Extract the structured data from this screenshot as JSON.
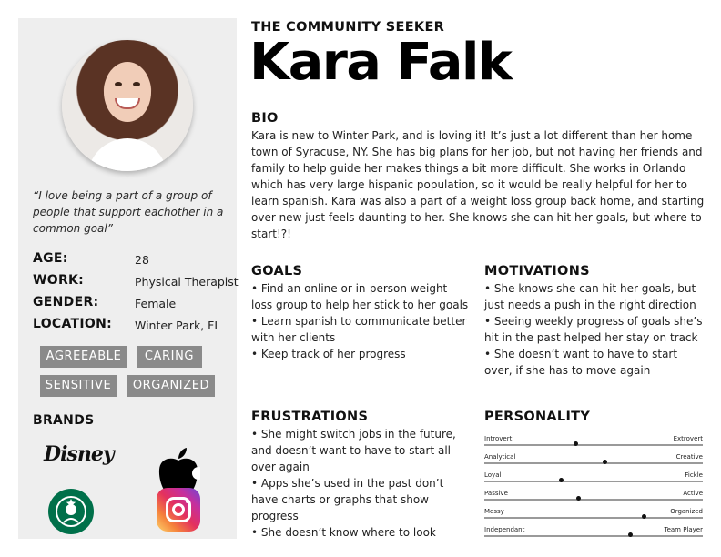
{
  "persona": {
    "kicker": "THE COMMUNITY SEEKER",
    "name": "Kara Falk",
    "quote": "“I love being a part of a group of people that support eachother in a common goal”"
  },
  "stats": [
    {
      "label": "AGE:",
      "value": "28"
    },
    {
      "label": "WORK:",
      "value": "Physical Therapist"
    },
    {
      "label": "GENDER:",
      "value": "Female"
    },
    {
      "label": "LOCATION:",
      "value": "Winter Park, FL"
    }
  ],
  "tags": [
    "AGREEABLE",
    "CARING",
    "SENSITIVE",
    "ORGANIZED"
  ],
  "brands": {
    "title": "BRANDS",
    "disney": "Disney",
    "starbucks": "STARBUCKS COFFEE",
    "icons": [
      "disney-logo",
      "apple-logo",
      "starbucks-logo",
      "instagram-logo"
    ]
  },
  "bio": {
    "title": "BIO",
    "text": "Kara is new to Winter Park, and is loving it! It’s just a lot different than her home town of Syracuse, NY. She has big plans for her job, but not having her friends and family to help guide her makes things a bit more difficult. She works in Orlando which has very large hispanic population, so it would be really helpful for her to learn spanish. Kara was also a part of a weight loss group back home, and starting over new just feels daunting to her. She knows she can hit her goals, but where to start!?!"
  },
  "goals": {
    "title": "GOALS",
    "items": [
      "• Find an online or in-person weight loss group to help her stick to her goals",
      "• Learn spanish to communicate better with her clients",
      "• Keep track of her progress"
    ]
  },
  "motivations": {
    "title": "MOTIVATIONS",
    "items": [
      "• She knows she can hit her goals, but just needs a push in the right direction",
      "• Seeing weekly progress of goals she’s hit in the past helped her stay on track",
      "• She doesn’t want to have to start over, if she has to move again"
    ]
  },
  "frustrations": {
    "title": "FRUSTRATIONS",
    "items": [
      "• She might switch jobs in the future, and doesn’t want to have to start all over again",
      "• Apps she’s used in the past don’t have charts or graphs that show progress",
      "• She doesn’t know where to look"
    ]
  },
  "personality": {
    "title": "PERSONALITY",
    "traits": [
      {
        "left": "Introvert",
        "right": "Extrovert",
        "level": 0.42
      },
      {
        "left": "Analytical",
        "right": "Creative",
        "level": 0.55
      },
      {
        "left": "Loyal",
        "right": "Fickle",
        "level": 0.35
      },
      {
        "left": "Passive",
        "right": "Active",
        "level": 0.43
      },
      {
        "left": "Messy",
        "right": "Organized",
        "level": 0.73
      },
      {
        "left": "Independant",
        "right": "Team Player",
        "level": 0.67
      }
    ]
  },
  "colors": {
    "sidebar_bg": "#eeeeee",
    "tag_bg": "#8a8a8a",
    "text": "#1a1a1a"
  }
}
